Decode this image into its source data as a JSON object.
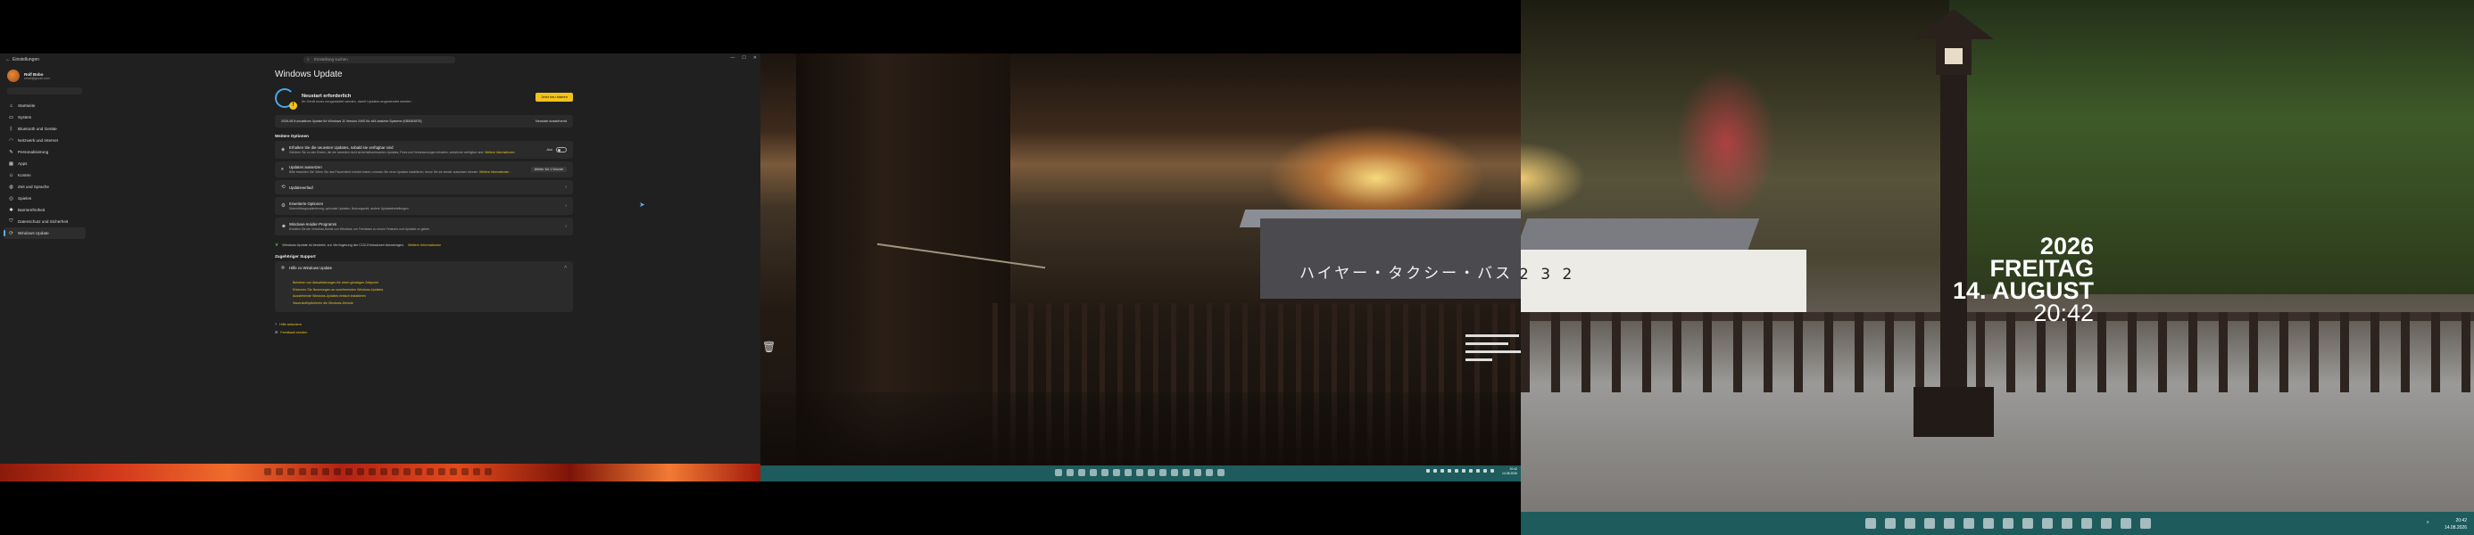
{
  "monitor1": {
    "titlebar": {
      "app_title": "Einstellungen",
      "search_placeholder": "Einstellung suchen"
    },
    "user": {
      "name": "Rolf Bobo",
      "email": "email@gmail.com"
    },
    "sidebar": {
      "items": [
        {
          "label": "Startseite",
          "icon": "home-icon"
        },
        {
          "label": "System",
          "icon": "monitor-icon"
        },
        {
          "label": "Bluetooth und Geräte",
          "icon": "bluetooth-icon"
        },
        {
          "label": "Netzwerk und Internet",
          "icon": "wifi-icon"
        },
        {
          "label": "Personalisierung",
          "icon": "brush-icon"
        },
        {
          "label": "Apps",
          "icon": "apps-icon"
        },
        {
          "label": "Konten",
          "icon": "user-icon"
        },
        {
          "label": "Zeit und Sprache",
          "icon": "globe-icon"
        },
        {
          "label": "Spielen",
          "icon": "gamepad-icon"
        },
        {
          "label": "Barrierefreiheit",
          "icon": "accessibility-icon"
        },
        {
          "label": "Datenschutz und Sicherheit",
          "icon": "shield-icon"
        },
        {
          "label": "Windows Update",
          "icon": "update-icon",
          "active": true
        }
      ]
    },
    "main": {
      "title": "Windows Update",
      "status_title": "Neustart erforderlich",
      "status_sub": "Ihr Gerät muss neugestartet werden, damit Updates angewendet werden",
      "restart_button": "Jetzt neu starten",
      "update_item": "2026-08 Kumulatives Update für Windows 11 Version 24H2 für x64-basierte Systeme (KB5063878)",
      "update_status": "Neustart ausstehend",
      "more_options": "Weitere Optionen",
      "latest_title": "Erhalten Sie die neuesten Updates, sobald sie verfügbar sind",
      "latest_sub": "Gehören Sie zu den Ersten, die die neuesten nicht sicherheitsrelevanten Updates, Fixes und Verbesserungen erhalten, sobald sie verfügbar sind.",
      "latest_link": "Weitere Informationen",
      "latest_value": "Aus",
      "pause_title": "Updates aussetzen",
      "pause_sub": "Bitte beachten Sie: Wenn Sie das Pausenlimit erreicht haben, müssen Sie neue Updates installieren, bevor Sie sie wieder aussetzen können.",
      "pause_link": "Weitere Informationen",
      "pause_value": "Weiter für 1 Woche",
      "history": "Updateverlauf",
      "advanced_title": "Erweiterte Optionen",
      "advanced_sub": "Übermittlungsoptimierung, optionale Updates, Nutzungszeit, andere Updateeinstellungen",
      "insider_title": "Windows-Insider-Programm",
      "insider_sub": "Erhalten Sie die Vorschau-Builds von Windows, um Feedback zu neuen Features und Updates zu geben",
      "carbon_text": "Windows Update ist bestrebt, zur Verringerung der CO2-Emissionen beizutragen.",
      "carbon_link": "Weitere Informationen",
      "support_title": "Zugehöriger Support",
      "help_title": "Hilfe zu Windows Update",
      "help_links": [
        "Beheben von Aktualisierungen für einen günstigen Zeitpunkt",
        "Erkennen Sie Neuerungen an zunehmenden Windows-Updates",
        "Ausstehende Windows-Updates einfach installieren",
        "Sauerstoffoptimieren die Windows-Dienste"
      ],
      "get_help": "Hilfe anfordern",
      "feedback": "Feedback senden"
    }
  },
  "monitor2": {
    "sign_text": "ハイヤー・タクシー・バス",
    "timestamp": "20:42\n14.08.2026"
  },
  "monitor3": {
    "sign_text": "2  3  2",
    "clock_widget": {
      "year": "2026",
      "weekday": "FREITAG",
      "date": "14. AUGUST",
      "time": "20:42"
    },
    "taskbar_time": "20:42",
    "taskbar_date": "14.08.2026"
  },
  "colors": {
    "accent": "#f2c21b",
    "taskbar": "#1e5b5d",
    "settings_bg": "#202020"
  }
}
